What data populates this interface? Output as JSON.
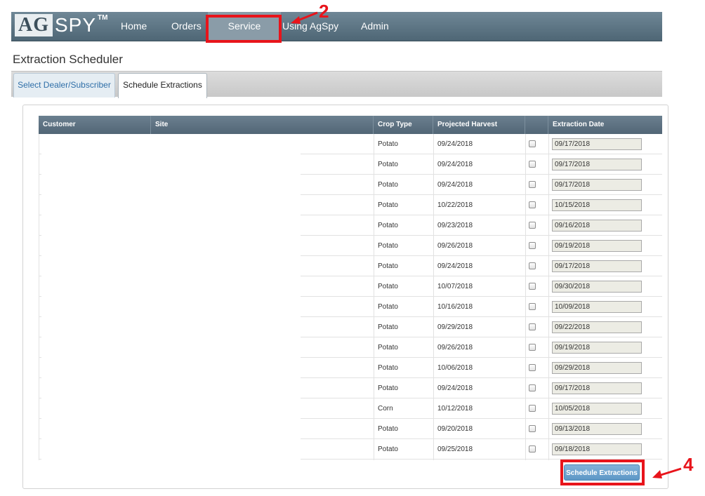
{
  "nav": {
    "logo_ag": "AG",
    "logo_spy": "SPY",
    "logo_tm": "TM",
    "items": [
      {
        "label": "Home"
      },
      {
        "label": "Orders"
      },
      {
        "label": "Service"
      },
      {
        "label": "Using AgSpy"
      },
      {
        "label": "Admin"
      }
    ]
  },
  "annotations": {
    "step_service": "2",
    "step_schedule": "4",
    "color": "#e8141b"
  },
  "page_title": "Extraction Scheduler",
  "tabs": [
    {
      "label": "Select Dealer/Subscriber",
      "active": false
    },
    {
      "label": "Schedule Extractions",
      "active": true
    }
  ],
  "table": {
    "columns": [
      "Customer",
      "Site",
      "Crop Type",
      "Projected Harvest",
      "",
      "Extraction Date"
    ],
    "rows": [
      {
        "crop": "Potato",
        "harvest": "09/24/2018",
        "extraction": "09/17/2018"
      },
      {
        "crop": "Potato",
        "harvest": "09/24/2018",
        "extraction": "09/17/2018"
      },
      {
        "crop": "Potato",
        "harvest": "09/24/2018",
        "extraction": "09/17/2018"
      },
      {
        "crop": "Potato",
        "harvest": "10/22/2018",
        "extraction": "10/15/2018"
      },
      {
        "crop": "Potato",
        "harvest": "09/23/2018",
        "extraction": "09/16/2018"
      },
      {
        "crop": "Potato",
        "harvest": "09/26/2018",
        "extraction": "09/19/2018"
      },
      {
        "crop": "Potato",
        "harvest": "09/24/2018",
        "extraction": "09/17/2018"
      },
      {
        "crop": "Potato",
        "harvest": "10/07/2018",
        "extraction": "09/30/2018"
      },
      {
        "crop": "Potato",
        "harvest": "10/16/2018",
        "extraction": "10/09/2018"
      },
      {
        "crop": "Potato",
        "harvest": "09/29/2018",
        "extraction": "09/22/2018"
      },
      {
        "crop": "Potato",
        "harvest": "09/26/2018",
        "extraction": "09/19/2018"
      },
      {
        "crop": "Potato",
        "harvest": "10/06/2018",
        "extraction": "09/29/2018"
      },
      {
        "crop": "Potato",
        "harvest": "09/24/2018",
        "extraction": "09/17/2018"
      },
      {
        "crop": "Corn",
        "harvest": "10/12/2018",
        "extraction": "10/05/2018"
      },
      {
        "crop": "Potato",
        "harvest": "09/20/2018",
        "extraction": "09/13/2018"
      },
      {
        "crop": "Potato",
        "harvest": "09/25/2018",
        "extraction": "09/18/2018"
      }
    ]
  },
  "schedule_button_label": "Schedule Extractions"
}
